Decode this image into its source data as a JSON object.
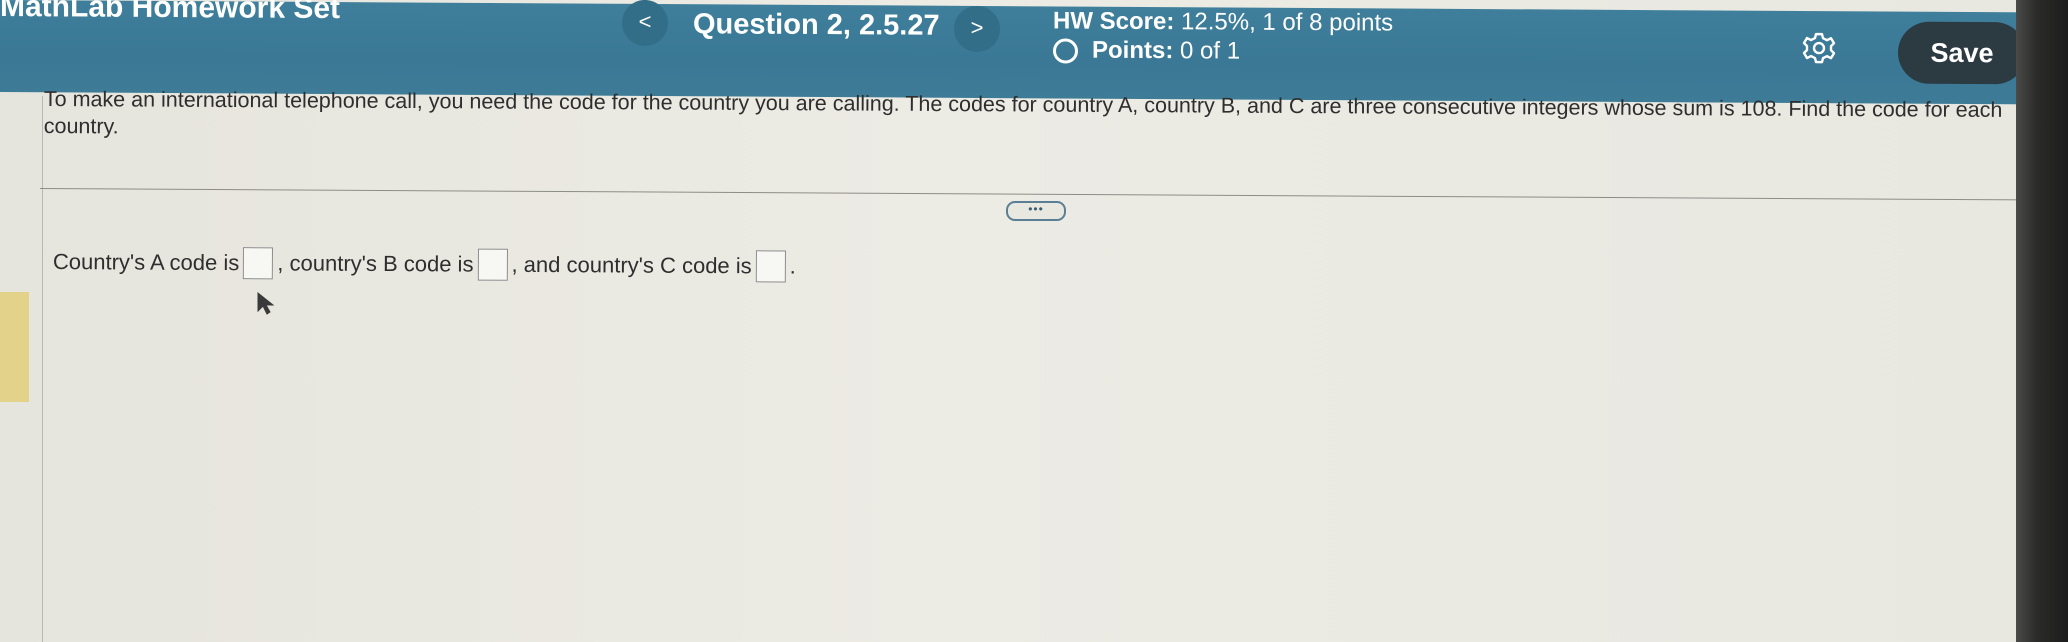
{
  "header": {
    "app_title": "MathLab Homework Set",
    "prev_label": "<",
    "question_label": "Question 2, 2.5.27",
    "next_label": ">",
    "score_label": "HW Score:",
    "score_value": "12.5%, 1 of 8 points",
    "points_label": "Points:",
    "points_value": "0 of 1",
    "save_label": "Save"
  },
  "problem": {
    "text": "To make an international telephone call, you need the code for the country you are calling. The codes for country A, country B, and C are three consecutive integers whose sum is 108. Find the code for each country."
  },
  "more_label": "•••",
  "answer": {
    "part_a": "Country's A code is",
    "part_b": ", country's B code is",
    "part_c": ", and country's C code is",
    "end": ".",
    "country_a_value": "",
    "country_b_value": "",
    "country_c_value": ""
  },
  "icons": {
    "settings": "gear-icon",
    "status": "circle-icon",
    "pointer": "cursor-icon"
  },
  "colors": {
    "header_bg": "#3c7a97",
    "save_bg": "#2c3a42",
    "page_bg": "#e9e8e1",
    "text": "#2e2e2e"
  }
}
